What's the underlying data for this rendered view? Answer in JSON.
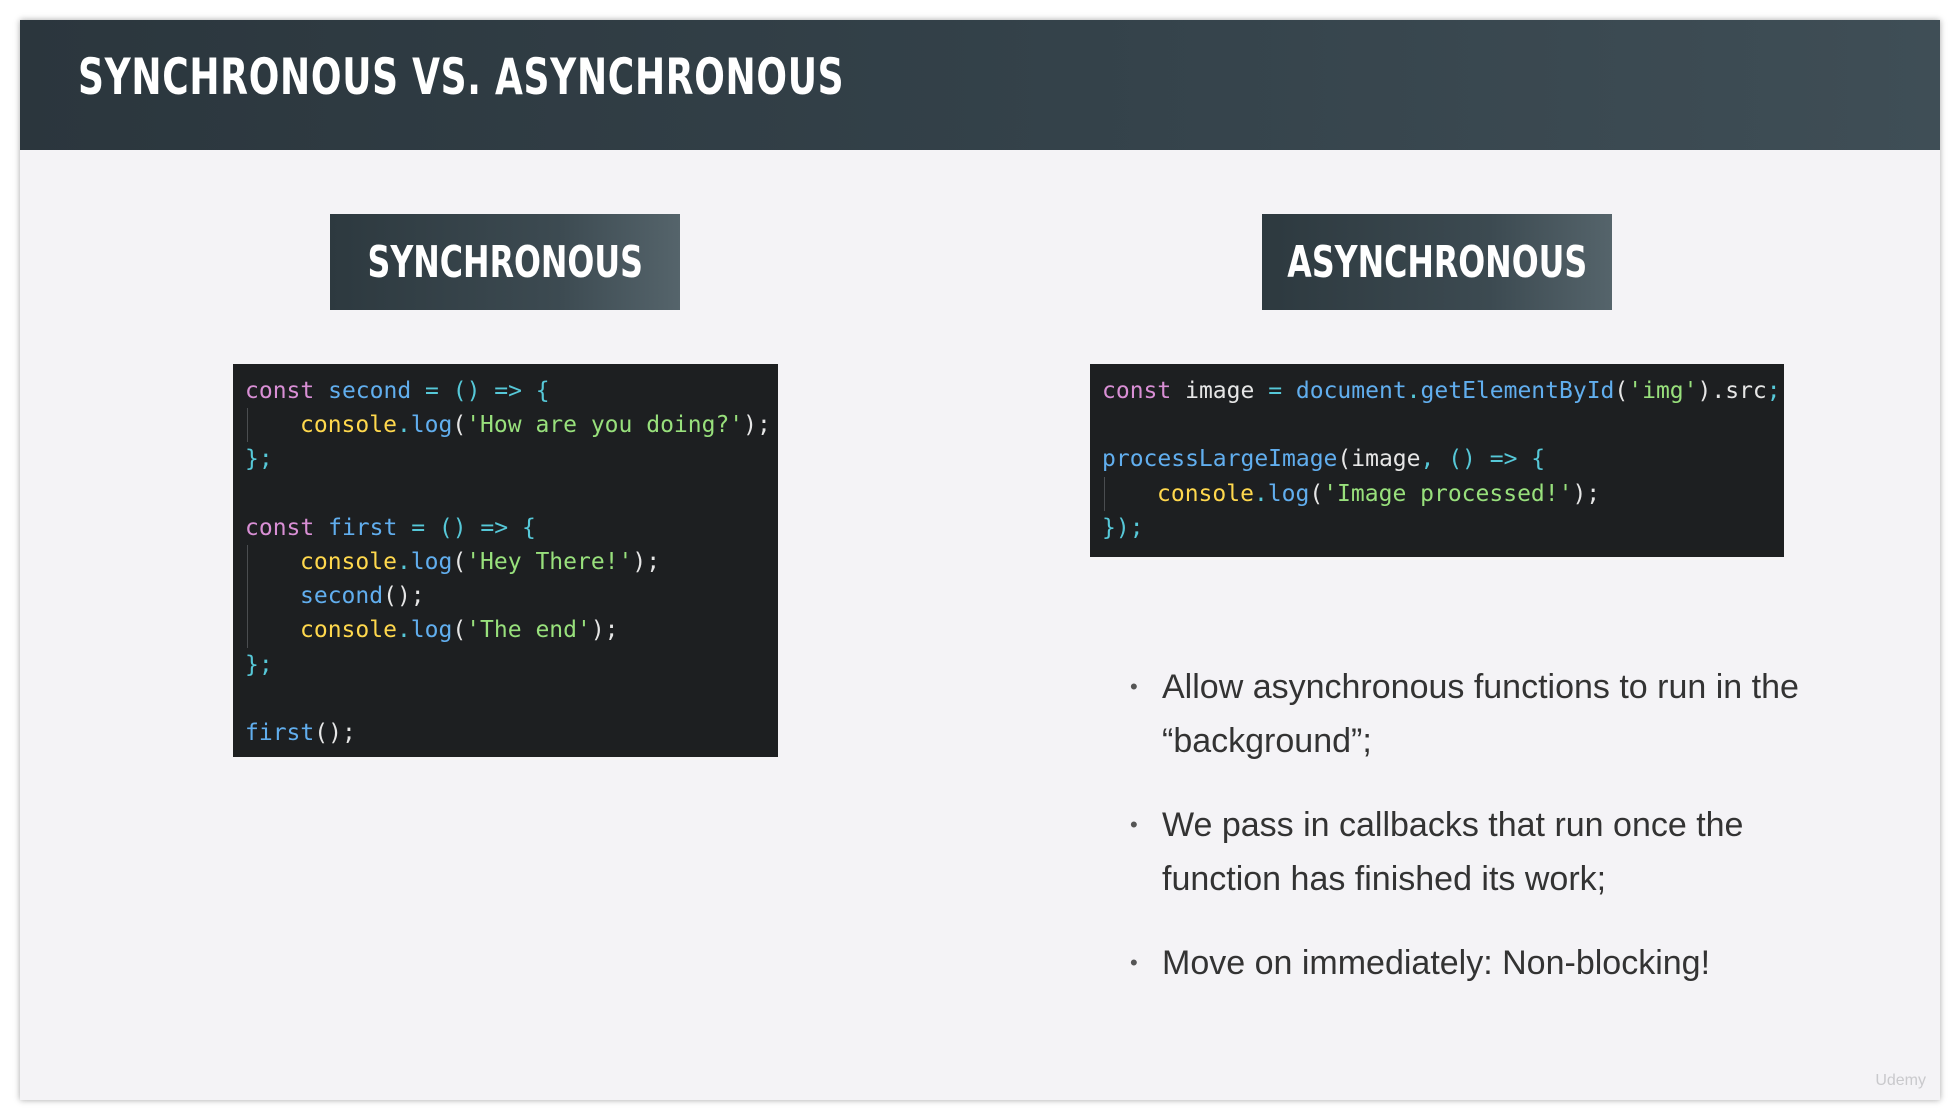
{
  "title": "SYNCHRONOUS VS. ASYNCHRONOUS",
  "columns": {
    "left_label": "SYNCHRONOUS",
    "right_label": "ASYNCHRONOUS"
  },
  "code_sync": [
    [
      [
        "kw",
        "const "
      ],
      [
        "fn",
        "second"
      ],
      [
        "op",
        " = () => {"
      ]
    ],
    [
      [
        "obj",
        "console"
      ],
      [
        "op",
        "."
      ],
      [
        "fn",
        "log"
      ],
      [
        "pl",
        "("
      ],
      [
        "str",
        "'How are you doing?'"
      ],
      [
        "pl",
        ");"
      ]
    ],
    [
      [
        "op",
        "};"
      ]
    ],
    [],
    [
      [
        "kw",
        "const "
      ],
      [
        "fn",
        "first"
      ],
      [
        "op",
        " = () => {"
      ]
    ],
    [
      [
        "obj",
        "console"
      ],
      [
        "op",
        "."
      ],
      [
        "fn",
        "log"
      ],
      [
        "pl",
        "("
      ],
      [
        "str",
        "'Hey There!'"
      ],
      [
        "pl",
        ");"
      ]
    ],
    [
      [
        "fn",
        "second"
      ],
      [
        "pl",
        "();"
      ]
    ],
    [
      [
        "obj",
        "console"
      ],
      [
        "op",
        "."
      ],
      [
        "fn",
        "log"
      ],
      [
        "pl",
        "("
      ],
      [
        "str",
        "'The end'"
      ],
      [
        "pl",
        ");"
      ]
    ],
    [
      [
        "op",
        "};"
      ]
    ],
    [],
    [
      [
        "fn",
        "first"
      ],
      [
        "pl",
        "();"
      ]
    ]
  ],
  "code_sync_indent": [
    false,
    true,
    false,
    false,
    false,
    true,
    true,
    true,
    false,
    false,
    false
  ],
  "code_async": [
    [
      [
        "kw",
        "const "
      ],
      [
        "pl",
        "image "
      ],
      [
        "op",
        "= "
      ],
      [
        "fn",
        "document"
      ],
      [
        "op",
        "."
      ],
      [
        "fn",
        "getElementById"
      ],
      [
        "pl",
        "("
      ],
      [
        "str",
        "'img'"
      ],
      [
        "pl",
        ")."
      ],
      [
        "pl",
        "src"
      ],
      [
        "op",
        ";"
      ]
    ],
    [],
    [
      [
        "fn",
        "processLargeImage"
      ],
      [
        "pl",
        "(image"
      ],
      [
        "op",
        ", () => {"
      ]
    ],
    [
      [
        "obj",
        "console"
      ],
      [
        "op",
        "."
      ],
      [
        "fn",
        "log"
      ],
      [
        "pl",
        "("
      ],
      [
        "str",
        "'Image processed!'"
      ],
      [
        "pl",
        ");"
      ]
    ],
    [
      [
        "op",
        "});"
      ]
    ]
  ],
  "code_async_indent": [
    false,
    false,
    false,
    true,
    false
  ],
  "bullets": [
    "Allow asynchronous functions to run in the “background”;",
    "We pass in callbacks that run once the function has finished its work;",
    "Move on immediately: Non-blocking!"
  ],
  "bullet_glyph": "•",
  "watermark": "Udemy",
  "colors": {
    "header_bg": "#34424a",
    "slide_bg": "#f4f3f6",
    "code_bg": "#1d1f21",
    "keyword": "#d98fd5",
    "function": "#61aeee",
    "operator": "#56c8d8",
    "object": "#ffd84d",
    "string": "#98e07c"
  }
}
